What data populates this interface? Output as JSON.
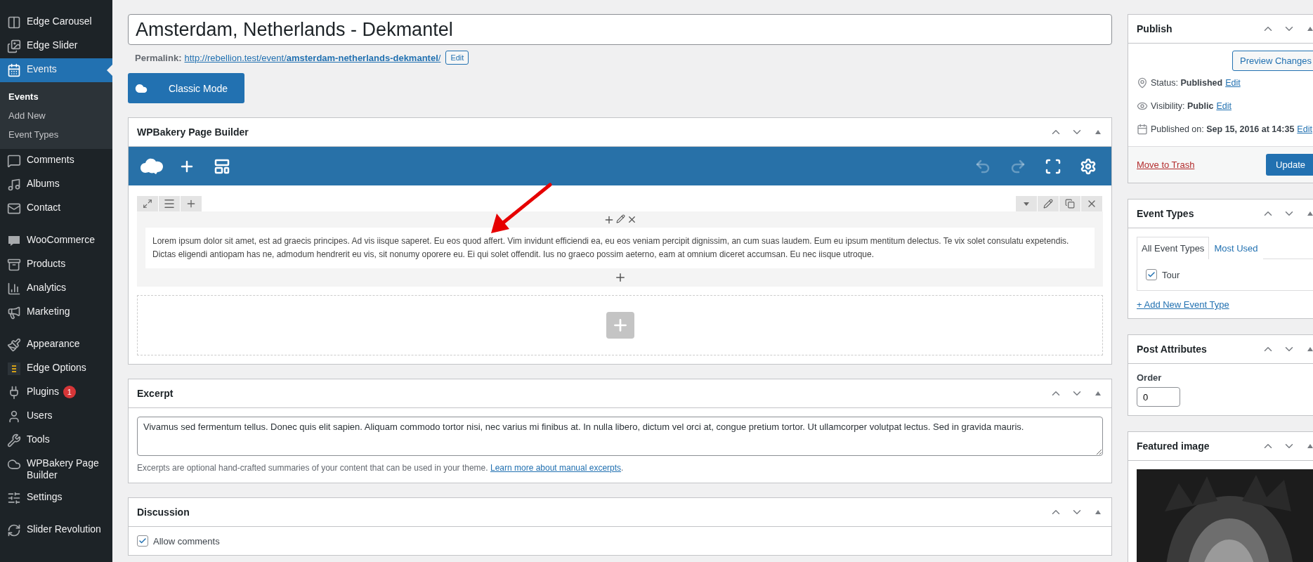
{
  "sidebar": {
    "groups": [
      [
        {
          "label": "Edge Carousel",
          "selected": false
        },
        {
          "label": "Edge Slider",
          "selected": false
        },
        {
          "label": "Events",
          "selected": true,
          "children": [
            {
              "label": "Events",
              "selected": true
            },
            {
              "label": "Add New",
              "selected": false
            },
            {
              "label": "Event Types",
              "selected": false
            }
          ]
        },
        {
          "label": "Comments",
          "selected": false
        },
        {
          "label": "Albums",
          "selected": false
        },
        {
          "label": "Contact",
          "selected": false
        }
      ],
      [
        {
          "label": "WooCommerce",
          "selected": false
        },
        {
          "label": "Products",
          "selected": false
        },
        {
          "label": "Analytics",
          "selected": false
        },
        {
          "label": "Marketing",
          "selected": false
        }
      ],
      [
        {
          "label": "Appearance",
          "selected": false
        },
        {
          "label": "Edge Options",
          "selected": false
        },
        {
          "label": "Plugins",
          "selected": false,
          "badge": "1"
        },
        {
          "label": "Users",
          "selected": false
        },
        {
          "label": "Tools",
          "selected": false
        },
        {
          "label": "WPBakery Page Builder",
          "selected": false
        },
        {
          "label": "Settings",
          "selected": false
        }
      ],
      [
        {
          "label": "Slider Revolution",
          "selected": false
        }
      ]
    ]
  },
  "title": {
    "value": "Amsterdam, Netherlands - Dekmantel"
  },
  "permalink": {
    "label": "Permalink:",
    "url_base": "http://rebellion.test/event/",
    "slug": "amsterdam-netherlands-dekmantel",
    "url_end": "/",
    "edit": "Edit"
  },
  "classic_mode_button": "Classic Mode",
  "page_builder": {
    "title": "WPBakery Page Builder",
    "toolbar": [
      {
        "disabled": false
      },
      {
        "disabled": false
      },
      {
        "disabled": false
      },
      {
        "disabled": true
      },
      {
        "disabled": true
      },
      {
        "disabled": false
      },
      {
        "disabled": false
      }
    ],
    "text_block": "Lorem ipsum dolor sit amet, est ad graecis principes. Ad vis iisque saperet. Eu eos quod affert. Vim invidunt efficiendi ea, eu eos veniam percipit dignissim, an cum suas laudem. Eum eu ipsum mentitum delectus. Te vix solet consulatu expetendis. Dictas eligendi antiopam has ne, admodum hendrerit eu vis, sit nonumy oporere eu. Ei qui solet offendit. Ius no graeco possim aeterno, eam at omnium diceret accumsan. Eu nec iisque utroque."
  },
  "excerpt": {
    "title": "Excerpt",
    "value": "Vivamus sed fermentum tellus. Donec quis elit sapien. Aliquam commodo tortor nisi, nec varius mi finibus at. In nulla libero, dictum vel orci at, congue pretium tortor. Ut ullamcorper volutpat lectus. Sed in gravida mauris.",
    "help": "Excerpts are optional hand-crafted summaries of your content that can be used in your theme.",
    "help_link": "Learn more about manual excerpts",
    "help_end": "."
  },
  "discussion": {
    "title": "Discussion",
    "options": [
      {
        "label": "Allow comments",
        "checked": true
      }
    ]
  },
  "publish": {
    "title": "Publish",
    "preview": "Preview Changes",
    "rows": [
      {
        "label": "Status:",
        "value": "Published",
        "edit": "Edit"
      },
      {
        "label": "Visibility:",
        "value": "Public",
        "edit": "Edit"
      },
      {
        "label": "Published on:",
        "value": "Sep 15, 2016 at 14:35",
        "edit": "Edit"
      }
    ],
    "trash": "Move to Trash",
    "update": "Update"
  },
  "event_types": {
    "title": "Event Types",
    "tabs": [
      {
        "label": "All Event Types",
        "selected": true
      },
      {
        "label": "Most Used",
        "selected": false
      }
    ],
    "items": [
      {
        "label": "Tour",
        "checked": true
      }
    ],
    "add_new": "+ Add New Event Type"
  },
  "post_attributes": {
    "title": "Post Attributes",
    "order_label": "Order",
    "order_value": "0"
  },
  "featured_image": {
    "title": "Featured image",
    "kind": "picture"
  }
}
